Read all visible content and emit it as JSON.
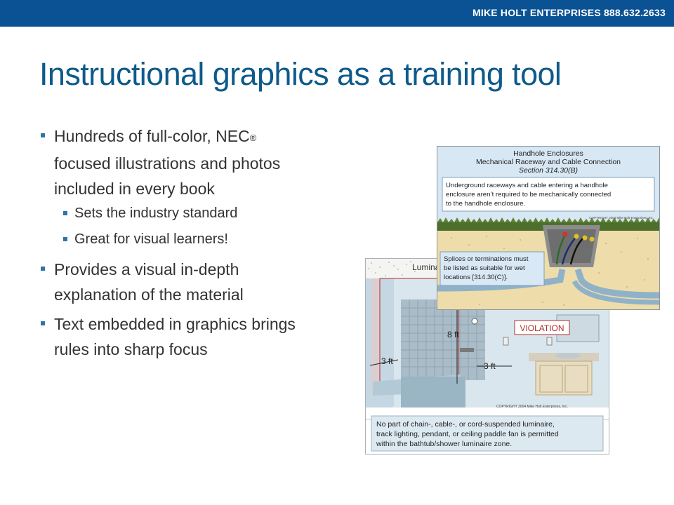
{
  "header": {
    "brand": "MIKE HOLT ENTERPRISES 888.632.2633",
    "bar_color": "#0b5294"
  },
  "slide": {
    "title": "Instructional graphics as a training tool",
    "bullets": [
      {
        "lines": [
          "Hundreds of full-color, NEC",
          "focused illustrations and photos",
          "included in every book"
        ],
        "reg_mark": "®",
        "sub": [
          "Sets the industry standard",
          "Great for visual learners!"
        ]
      },
      {
        "lines": [
          "Provides a visual in-depth",
          "explanation of the material"
        ]
      },
      {
        "lines": [
          "Text embedded in graphics brings",
          "rules into sharp focus"
        ]
      }
    ]
  },
  "figure_handhole": {
    "title": "Handhole Enclosures",
    "subtitle": "Mechanical Raceway and Cable Connection",
    "section": "Section 314.30(B)",
    "callout_lines": [
      "Underground raceways and cable entering a handhole",
      "enclosure aren’t required to be mechanically connected",
      "to the handhole enclosure."
    ],
    "copyright": "COPYRIGHT 2004  Mike Holt Enterprises, Inc.",
    "note_lines": [
      "Splices or terminations must",
      "be listed as suitable for wet",
      "locations [314.30(C)]."
    ]
  },
  "figure_bath": {
    "label_partial": "Lumina",
    "dim_height": "8 ft",
    "dim_left": "3 ft",
    "dim_front": "3 ft",
    "violation": "VIOLATION",
    "copyright": "COPYRIGHT 2004  Mike Holt Enterprises, Inc.",
    "caption_lines": [
      "No part of chain-, cable-, or cord-suspended luminaire,",
      "track lighting, pendant, or ceiling paddle fan is permitted",
      "within the bathtub/shower luminaire zone."
    ]
  }
}
